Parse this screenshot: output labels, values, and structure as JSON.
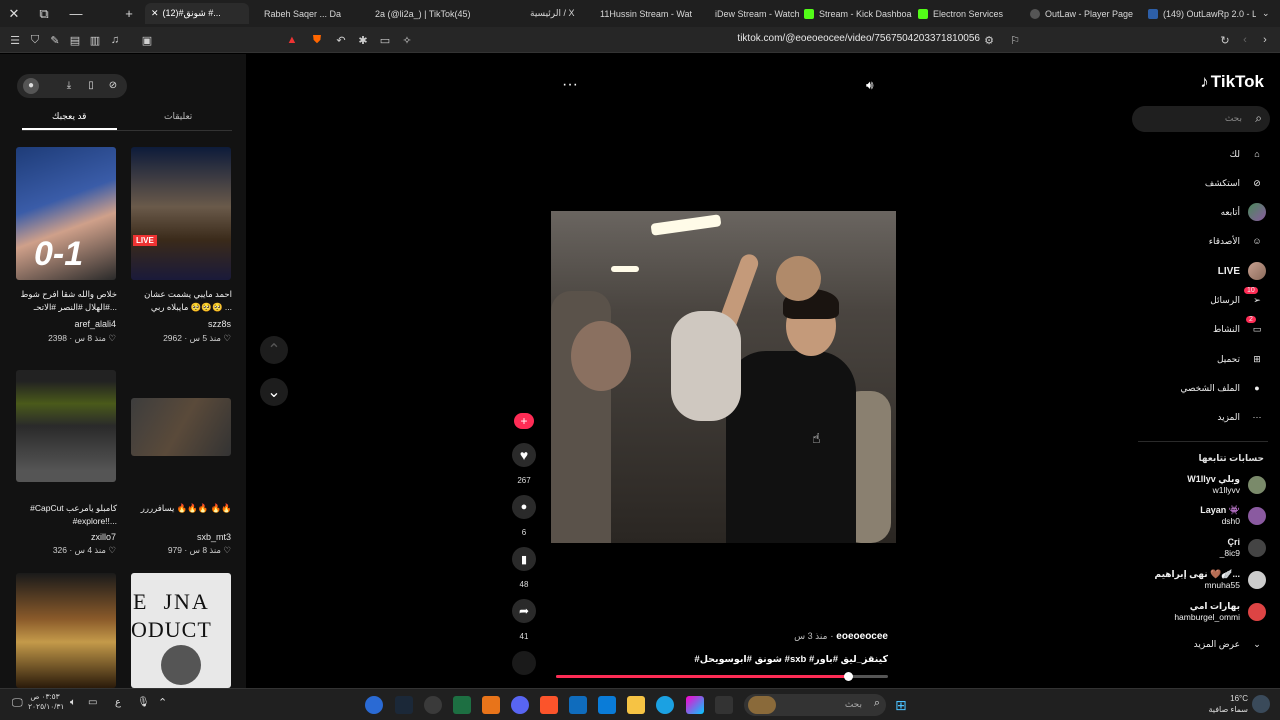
{
  "browser": {
    "tabs": [
      {
        "label": "(12)#شونق #...",
        "color": "#555"
      },
      {
        "label": "Rabeh Saqer ... Da",
        "color": "#3b5ba8"
      },
      {
        "label": "2a (@li2a_) | TikTok(45)",
        "color": "#222"
      },
      {
        "label": "الرئيسية / X",
        "color": "#000"
      },
      {
        "label": "11Hussin Stream - Wat",
        "color": "#53fc18"
      },
      {
        "label": "iDew Stream - Watch l",
        "color": "#53fc18"
      },
      {
        "label": "Stream - Kick Dashboa",
        "color": "#53fc18"
      },
      {
        "label": "Electron Services",
        "color": "#333"
      },
      {
        "label": "OutLaw - Player Page",
        "color": "#444"
      },
      {
        "label": "(149) OutLawRp 2.0 - L",
        "color": "#2d5fa8"
      }
    ],
    "url": "tiktok.com/@eoeoeocee/video/7567504203371810056"
  },
  "left_panel": {
    "tabs": {
      "for_you": "قد يعجبك",
      "comments": "تعليقات"
    },
    "cards": [
      {
        "text": "خلاص والله شقا افرح شوط #الهلال #النصر #الاتحـ...",
        "user": "aref_alali4",
        "likes": "2398",
        "time": "منذ 8 س",
        "thumb": "#2d4a7a"
      },
      {
        "text": "احمد مايبي يشمت عشان مايبلاه ربي 🥺🥺🥺 ...",
        "user": "szz8s",
        "likes": "2962",
        "time": "منذ 5 س",
        "thumb": "#6a4a2a"
      },
      {
        "text": "#CapCut كامبلو يامرعب #explore!!...",
        "user": "zxillo7",
        "likes": "326",
        "time": "منذ 4 س",
        "thumb": "#3a4a30"
      },
      {
        "text": "يسافرررر 🔥🔥🔥 🔥🔥",
        "user": "sxb_mt3",
        "likes": "979",
        "time": "منذ 8 س",
        "thumb": "#3d3d3d"
      },
      {
        "text": "",
        "user": "",
        "likes": "",
        "time": "",
        "thumb": "#5a3a1a"
      },
      {
        "text": "",
        "user": "",
        "likes": "",
        "time": "",
        "thumb": "#ddd"
      }
    ]
  },
  "video": {
    "likes": "267",
    "comments": "6",
    "saves": "48",
    "shares": "41",
    "username": "eoeoeocee",
    "time": "منذ 3 س",
    "caption": "#شونق #ابوسويحل #sxb #كينقز_ليق #باور",
    "progress": 0.88
  },
  "sidebar": {
    "logo": "TikTok",
    "search_placeholder": "بحث",
    "nav": [
      {
        "label": "لك",
        "icon": "home-icon"
      },
      {
        "label": "استكشف",
        "icon": "compass-icon"
      },
      {
        "label": "أتابعه",
        "icon": "following-avatar-icon"
      },
      {
        "label": "الأصدقاء",
        "icon": "friends-icon"
      },
      {
        "label": "LIVE",
        "icon": "live-icon"
      },
      {
        "label": "الرسائل",
        "icon": "messages-icon",
        "badge": "10"
      },
      {
        "label": "النشاط",
        "icon": "activity-icon",
        "badge": "2"
      },
      {
        "label": "تحميل",
        "icon": "upload-icon"
      },
      {
        "label": "الملف الشخصي",
        "icon": "profile-icon"
      },
      {
        "label": "المزيد",
        "icon": "more-icon"
      }
    ],
    "following_title": "حسابات تتابعها",
    "following": [
      {
        "name": "W1llyv وبلي",
        "handle": "w1llyvv",
        "color": "#7a8a6a"
      },
      {
        "name": "Layan 👾",
        "handle": "dsh0",
        "color": "#8a5aa0"
      },
      {
        "name": "Çri",
        "handle": "_8ic9",
        "color": "#444"
      },
      {
        "name": "نهى إبراهيم 🤎🪽...",
        "handle": "mnuha55",
        "color": "#ccc"
      },
      {
        "name": "بهارات امي",
        "handle": "hamburgel_ommi",
        "color": "#d44"
      }
    ],
    "show_more": "عرض المزيد"
  },
  "taskbar": {
    "time": "٠٣:٥٣ ص",
    "date": "٢٠٢٥/١٠/٣١",
    "weather_temp": "16°C",
    "weather_text": "سماء صافية",
    "search_placeholder": "بحث",
    "lang": "ع"
  }
}
